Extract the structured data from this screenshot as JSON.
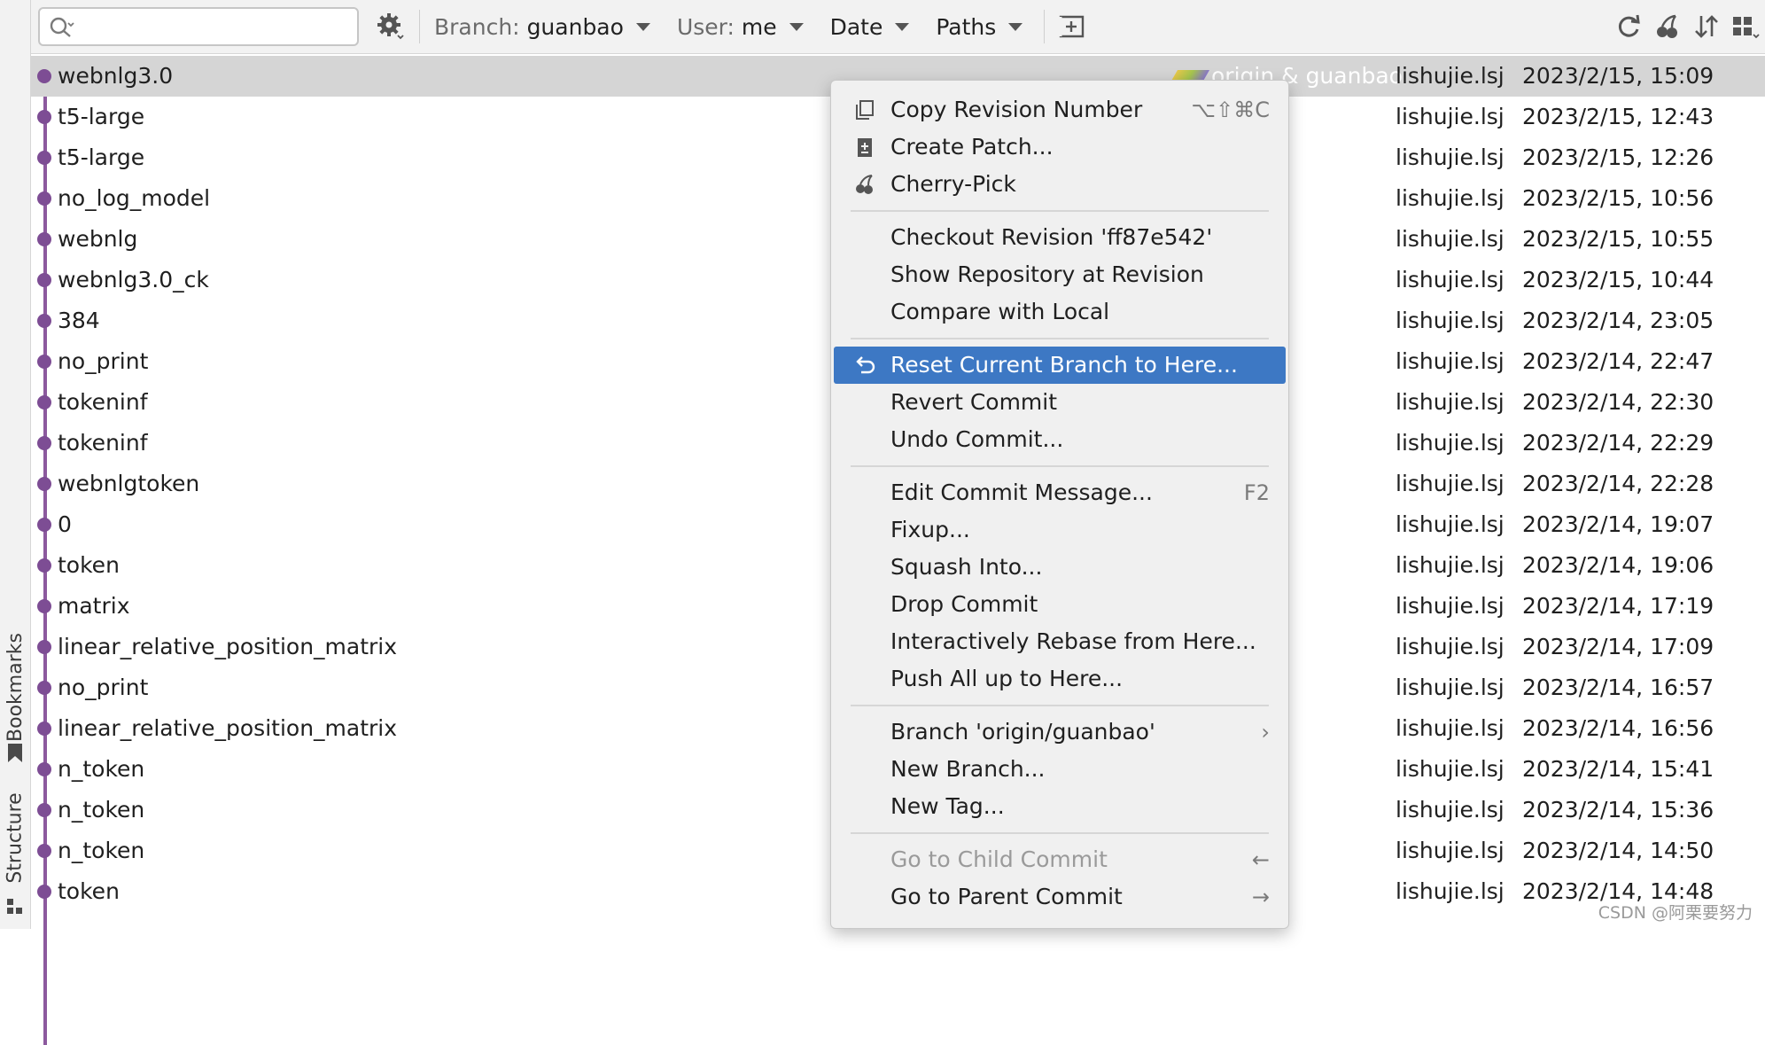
{
  "toolbar": {
    "search_placeholder": "",
    "branch_label": "Branch:",
    "branch_value": "guanbao",
    "user_label": "User:",
    "user_value": "me",
    "date_label": "Date",
    "paths_label": "Paths"
  },
  "left_strip": {
    "bookmarks_label": "Bookmarks",
    "structure_label": "Structure"
  },
  "refs_label": "origin & guanbao",
  "commits": [
    {
      "message": "webnlg3.0",
      "author": "lishujie.lsj",
      "date": "2023/2/15, 15:09"
    },
    {
      "message": "t5-large",
      "author": "lishujie.lsj",
      "date": "2023/2/15, 12:43"
    },
    {
      "message": "t5-large",
      "author": "lishujie.lsj",
      "date": "2023/2/15, 12:26"
    },
    {
      "message": "no_log_model",
      "author": "lishujie.lsj",
      "date": "2023/2/15, 10:56"
    },
    {
      "message": "webnlg",
      "author": "lishujie.lsj",
      "date": "2023/2/15, 10:55"
    },
    {
      "message": "webnlg3.0_ck",
      "author": "lishujie.lsj",
      "date": "2023/2/15, 10:44"
    },
    {
      "message": "384",
      "author": "lishujie.lsj",
      "date": "2023/2/14, 23:05"
    },
    {
      "message": "no_print",
      "author": "lishujie.lsj",
      "date": "2023/2/14, 22:47"
    },
    {
      "message": "tokeninf",
      "author": "lishujie.lsj",
      "date": "2023/2/14, 22:30"
    },
    {
      "message": "tokeninf",
      "author": "lishujie.lsj",
      "date": "2023/2/14, 22:29"
    },
    {
      "message": "webnlgtoken",
      "author": "lishujie.lsj",
      "date": "2023/2/14, 22:28"
    },
    {
      "message": "0",
      "author": "lishujie.lsj",
      "date": "2023/2/14, 19:07"
    },
    {
      "message": "token",
      "author": "lishujie.lsj",
      "date": "2023/2/14, 19:06"
    },
    {
      "message": "matrix",
      "author": "lishujie.lsj",
      "date": "2023/2/14, 17:19"
    },
    {
      "message": "linear_relative_position_matrix",
      "author": "lishujie.lsj",
      "date": "2023/2/14, 17:09"
    },
    {
      "message": "no_print",
      "author": "lishujie.lsj",
      "date": "2023/2/14, 16:57"
    },
    {
      "message": "linear_relative_position_matrix",
      "author": "lishujie.lsj",
      "date": "2023/2/14, 16:56"
    },
    {
      "message": "n_token",
      "author": "lishujie.lsj",
      "date": "2023/2/14, 15:41"
    },
    {
      "message": "n_token",
      "author": "lishujie.lsj",
      "date": "2023/2/14, 15:36"
    },
    {
      "message": "n_token",
      "author": "lishujie.lsj",
      "date": "2023/2/14, 14:50"
    },
    {
      "message": "token",
      "author": "lishujie.lsj",
      "date": "2023/2/14, 14:48"
    }
  ],
  "context_menu": {
    "items": [
      {
        "label": "Copy Revision Number",
        "shortcut": "⌥⇧⌘C",
        "icon": "copy-icon"
      },
      {
        "label": "Create Patch...",
        "shortcut": "",
        "icon": "patch-icon"
      },
      {
        "label": "Cherry-Pick",
        "shortcut": "",
        "icon": "cherry-icon"
      },
      {
        "label": "Checkout Revision 'ff87e542'",
        "shortcut": ""
      },
      {
        "label": "Show Repository at Revision",
        "shortcut": ""
      },
      {
        "label": "Compare with Local",
        "shortcut": ""
      },
      {
        "label": "Reset Current Branch to Here...",
        "shortcut": "",
        "icon": "reset-icon",
        "highlighted": true
      },
      {
        "label": "Revert Commit",
        "shortcut": ""
      },
      {
        "label": "Undo Commit...",
        "shortcut": ""
      },
      {
        "label": "Edit Commit Message...",
        "shortcut": "F2"
      },
      {
        "label": "Fixup...",
        "shortcut": ""
      },
      {
        "label": "Squash Into...",
        "shortcut": ""
      },
      {
        "label": "Drop Commit",
        "shortcut": ""
      },
      {
        "label": "Interactively Rebase from Here...",
        "shortcut": ""
      },
      {
        "label": "Push All up to Here...",
        "shortcut": ""
      },
      {
        "label": "Branch 'origin/guanbao'",
        "shortcut": "›"
      },
      {
        "label": "New Branch...",
        "shortcut": ""
      },
      {
        "label": "New Tag...",
        "shortcut": ""
      },
      {
        "label": "Go to Child Commit",
        "shortcut": "←",
        "disabled": true
      },
      {
        "label": "Go to Parent Commit",
        "shortcut": "→"
      }
    ]
  },
  "watermark": "CSDN @阿栗要努力",
  "colors": {
    "highlight": "#3d78c4",
    "graph": "#7d4d94",
    "selected_row": "#d5d5d5"
  }
}
